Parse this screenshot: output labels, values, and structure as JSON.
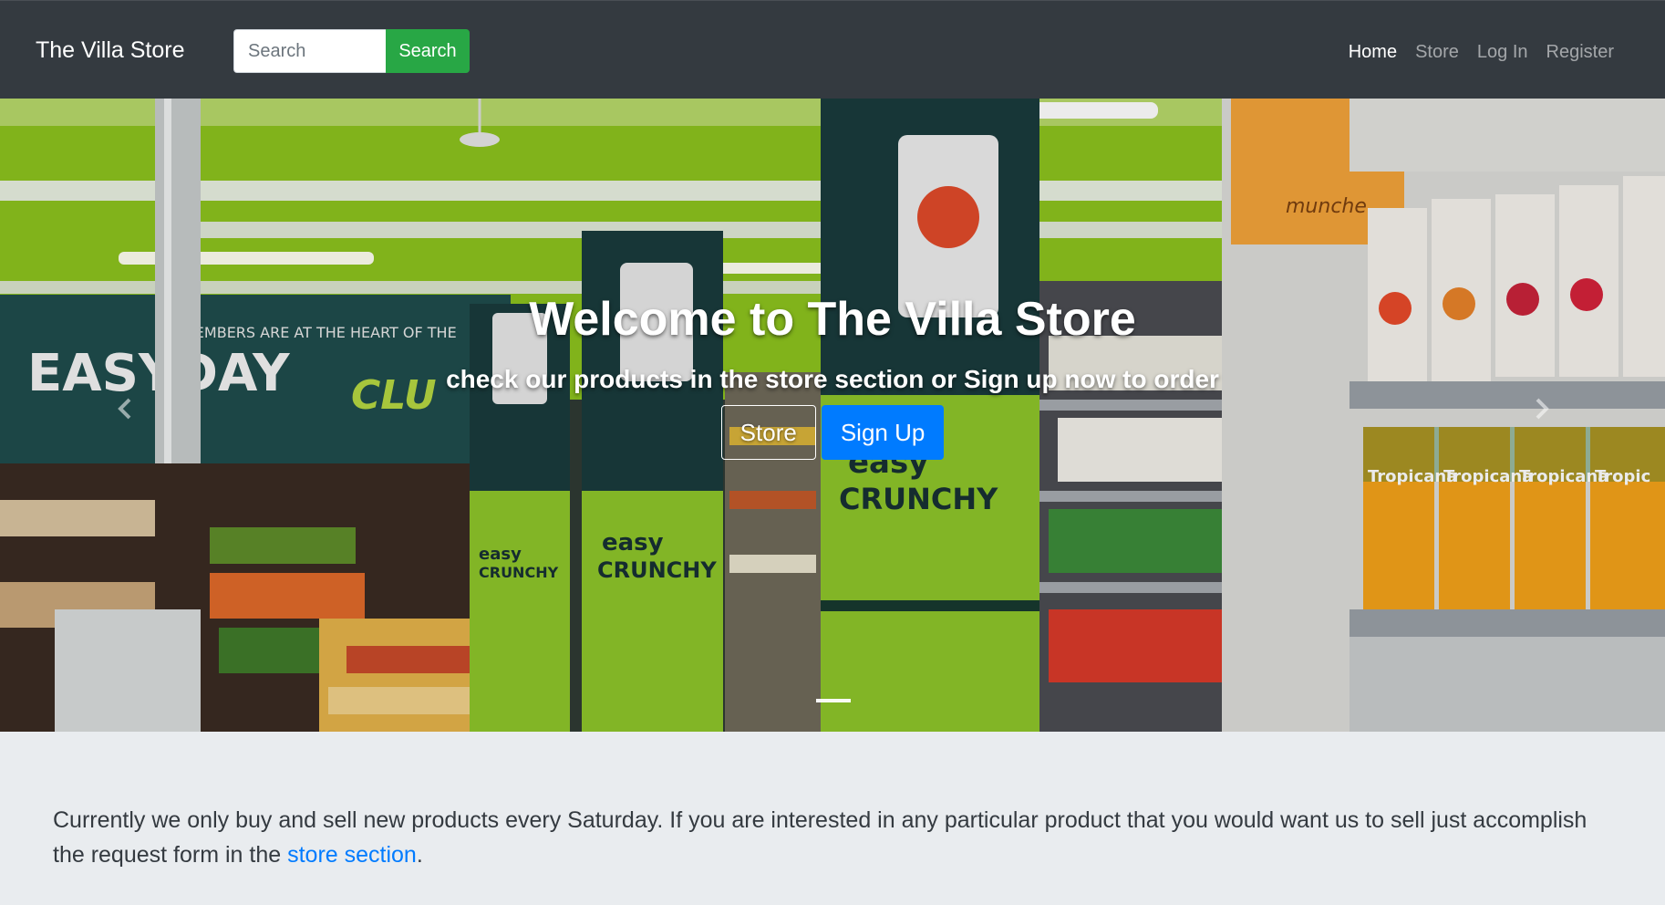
{
  "navbar": {
    "brand": "The Villa Store",
    "search": {
      "placeholder": "Search",
      "value": "",
      "button_label": "Search"
    },
    "links": [
      {
        "label": "Home",
        "active": true
      },
      {
        "label": "Store",
        "active": false
      },
      {
        "label": "Log In",
        "active": false
      },
      {
        "label": "Register",
        "active": false
      }
    ]
  },
  "hero": {
    "title": "Welcome to The Villa Store",
    "subtitle": "check our products in the store section or Sign up now to order",
    "buttons": {
      "store_label": "Store",
      "signup_label": "Sign Up"
    },
    "controls": {
      "prev_icon": "chevron-left-icon",
      "next_icon": "chevron-right-icon"
    },
    "slide_count": 1,
    "active_slide": 1
  },
  "content": {
    "text_before_link": "Currently we only buy and sell new products every Saturday. If you are interested in any particular product that you would want us to sell just accomplish the request form in the ",
    "link_text": "store section",
    "text_after_link": "."
  },
  "colors": {
    "navbar_bg": "#343a40",
    "search_button": "#28a745",
    "primary_button": "#007bff",
    "content_bg": "#e9ecef",
    "link": "#007bff"
  }
}
